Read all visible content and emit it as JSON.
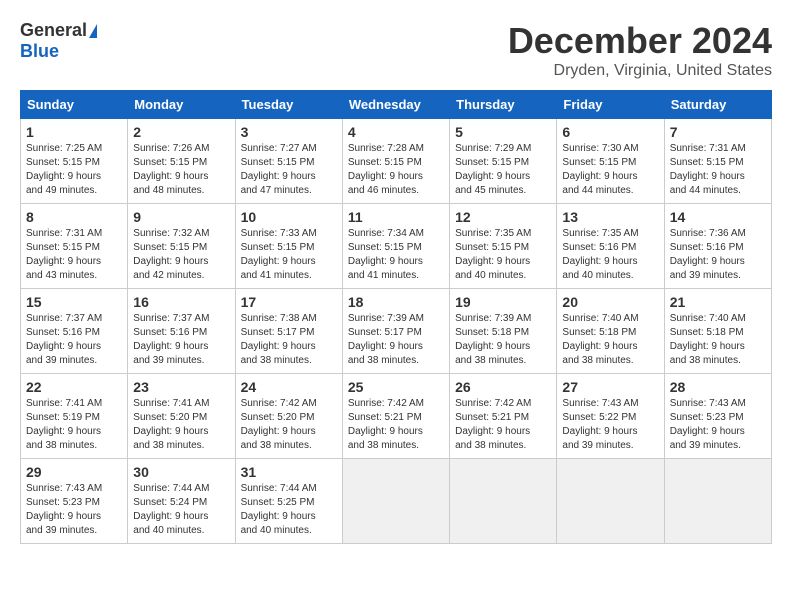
{
  "logo": {
    "general": "General",
    "blue": "Blue"
  },
  "header": {
    "month": "December 2024",
    "location": "Dryden, Virginia, United States"
  },
  "weekdays": [
    "Sunday",
    "Monday",
    "Tuesday",
    "Wednesday",
    "Thursday",
    "Friday",
    "Saturday"
  ],
  "weeks": [
    [
      {
        "day": "1",
        "info": "Sunrise: 7:25 AM\nSunset: 5:15 PM\nDaylight: 9 hours\nand 49 minutes."
      },
      {
        "day": "2",
        "info": "Sunrise: 7:26 AM\nSunset: 5:15 PM\nDaylight: 9 hours\nand 48 minutes."
      },
      {
        "day": "3",
        "info": "Sunrise: 7:27 AM\nSunset: 5:15 PM\nDaylight: 9 hours\nand 47 minutes."
      },
      {
        "day": "4",
        "info": "Sunrise: 7:28 AM\nSunset: 5:15 PM\nDaylight: 9 hours\nand 46 minutes."
      },
      {
        "day": "5",
        "info": "Sunrise: 7:29 AM\nSunset: 5:15 PM\nDaylight: 9 hours\nand 45 minutes."
      },
      {
        "day": "6",
        "info": "Sunrise: 7:30 AM\nSunset: 5:15 PM\nDaylight: 9 hours\nand 44 minutes."
      },
      {
        "day": "7",
        "info": "Sunrise: 7:31 AM\nSunset: 5:15 PM\nDaylight: 9 hours\nand 44 minutes."
      }
    ],
    [
      {
        "day": "8",
        "info": "Sunrise: 7:31 AM\nSunset: 5:15 PM\nDaylight: 9 hours\nand 43 minutes."
      },
      {
        "day": "9",
        "info": "Sunrise: 7:32 AM\nSunset: 5:15 PM\nDaylight: 9 hours\nand 42 minutes."
      },
      {
        "day": "10",
        "info": "Sunrise: 7:33 AM\nSunset: 5:15 PM\nDaylight: 9 hours\nand 41 minutes."
      },
      {
        "day": "11",
        "info": "Sunrise: 7:34 AM\nSunset: 5:15 PM\nDaylight: 9 hours\nand 41 minutes."
      },
      {
        "day": "12",
        "info": "Sunrise: 7:35 AM\nSunset: 5:15 PM\nDaylight: 9 hours\nand 40 minutes."
      },
      {
        "day": "13",
        "info": "Sunrise: 7:35 AM\nSunset: 5:16 PM\nDaylight: 9 hours\nand 40 minutes."
      },
      {
        "day": "14",
        "info": "Sunrise: 7:36 AM\nSunset: 5:16 PM\nDaylight: 9 hours\nand 39 minutes."
      }
    ],
    [
      {
        "day": "15",
        "info": "Sunrise: 7:37 AM\nSunset: 5:16 PM\nDaylight: 9 hours\nand 39 minutes."
      },
      {
        "day": "16",
        "info": "Sunrise: 7:37 AM\nSunset: 5:16 PM\nDaylight: 9 hours\nand 39 minutes."
      },
      {
        "day": "17",
        "info": "Sunrise: 7:38 AM\nSunset: 5:17 PM\nDaylight: 9 hours\nand 38 minutes."
      },
      {
        "day": "18",
        "info": "Sunrise: 7:39 AM\nSunset: 5:17 PM\nDaylight: 9 hours\nand 38 minutes."
      },
      {
        "day": "19",
        "info": "Sunrise: 7:39 AM\nSunset: 5:18 PM\nDaylight: 9 hours\nand 38 minutes."
      },
      {
        "day": "20",
        "info": "Sunrise: 7:40 AM\nSunset: 5:18 PM\nDaylight: 9 hours\nand 38 minutes."
      },
      {
        "day": "21",
        "info": "Sunrise: 7:40 AM\nSunset: 5:18 PM\nDaylight: 9 hours\nand 38 minutes."
      }
    ],
    [
      {
        "day": "22",
        "info": "Sunrise: 7:41 AM\nSunset: 5:19 PM\nDaylight: 9 hours\nand 38 minutes."
      },
      {
        "day": "23",
        "info": "Sunrise: 7:41 AM\nSunset: 5:20 PM\nDaylight: 9 hours\nand 38 minutes."
      },
      {
        "day": "24",
        "info": "Sunrise: 7:42 AM\nSunset: 5:20 PM\nDaylight: 9 hours\nand 38 minutes."
      },
      {
        "day": "25",
        "info": "Sunrise: 7:42 AM\nSunset: 5:21 PM\nDaylight: 9 hours\nand 38 minutes."
      },
      {
        "day": "26",
        "info": "Sunrise: 7:42 AM\nSunset: 5:21 PM\nDaylight: 9 hours\nand 38 minutes."
      },
      {
        "day": "27",
        "info": "Sunrise: 7:43 AM\nSunset: 5:22 PM\nDaylight: 9 hours\nand 39 minutes."
      },
      {
        "day": "28",
        "info": "Sunrise: 7:43 AM\nSunset: 5:23 PM\nDaylight: 9 hours\nand 39 minutes."
      }
    ],
    [
      {
        "day": "29",
        "info": "Sunrise: 7:43 AM\nSunset: 5:23 PM\nDaylight: 9 hours\nand 39 minutes."
      },
      {
        "day": "30",
        "info": "Sunrise: 7:44 AM\nSunset: 5:24 PM\nDaylight: 9 hours\nand 40 minutes."
      },
      {
        "day": "31",
        "info": "Sunrise: 7:44 AM\nSunset: 5:25 PM\nDaylight: 9 hours\nand 40 minutes."
      },
      null,
      null,
      null,
      null
    ]
  ]
}
